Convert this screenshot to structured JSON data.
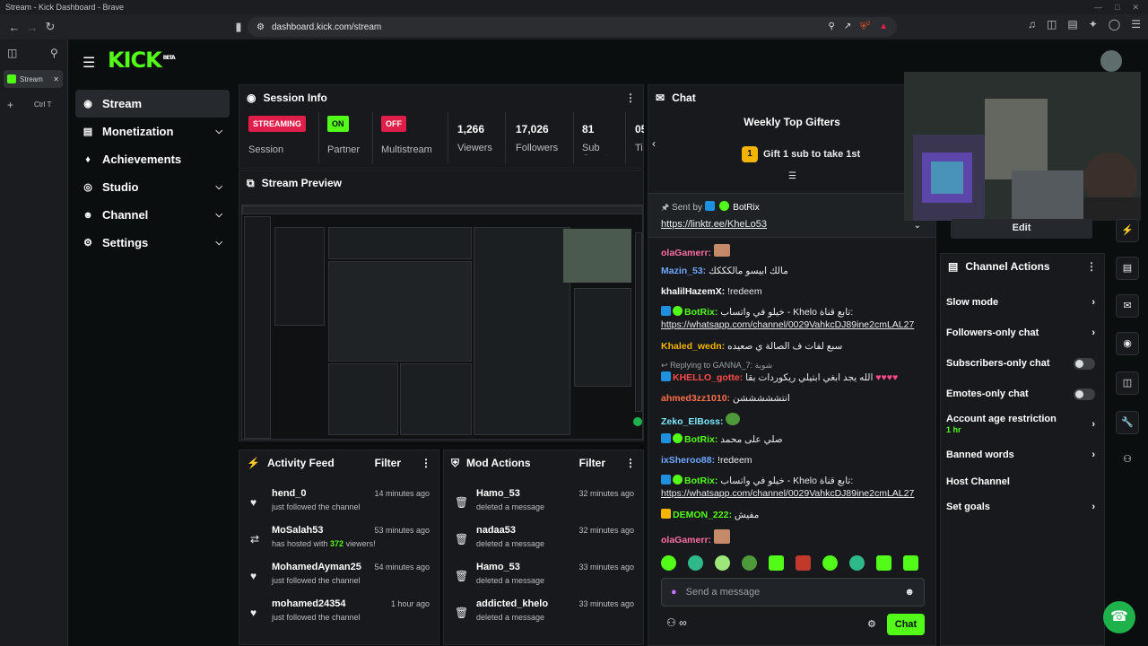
{
  "browser": {
    "window_title": "Stream - Kick Dashboard - Brave",
    "url": "dashboard.kick.com/stream",
    "tab_title": "Stream",
    "new_tab_hint": "Ctrl T",
    "shield_count": "2"
  },
  "app": {
    "logo": "KICK",
    "logo_badge": "BETA"
  },
  "sidebar": {
    "items": [
      {
        "label": "Stream",
        "icon": "stream-icon"
      },
      {
        "label": "Monetization",
        "icon": "dollar-icon"
      },
      {
        "label": "Achievements",
        "icon": "trophy-icon"
      },
      {
        "label": "Studio",
        "icon": "studio-icon"
      },
      {
        "label": "Channel",
        "icon": "user-icon"
      },
      {
        "label": "Settings",
        "icon": "gear-icon"
      }
    ]
  },
  "session": {
    "title": "Session Info",
    "streaming_badge": "STREAMING",
    "session_label": "Session",
    "partner_badge": "ON",
    "partner_label": "Partner",
    "multistream_badge": "OFF",
    "multistream_label": "Multistream",
    "viewers": "1,266",
    "viewers_label": "Viewers",
    "followers": "17,026",
    "followers_label": "Followers",
    "subs": "81",
    "subs_label": "Sub Counts",
    "extra_num": "05",
    "extra_label": "Ti"
  },
  "preview": {
    "title": "Stream Preview"
  },
  "activity": {
    "title": "Activity Feed",
    "filter": "Filter",
    "rows": [
      {
        "name": "hend_0",
        "sub": "just followed the channel",
        "time": "14 minutes ago"
      },
      {
        "name": "MoSalah53",
        "sub_pre": "has hosted with ",
        "sub_hl": "372",
        "sub_post": " viewers!",
        "time": "53 minutes ago"
      },
      {
        "name": "MohamedAyman25",
        "sub": "just followed the channel",
        "time": "54 minutes ago"
      },
      {
        "name": "mohamed24354",
        "sub": "just followed the channel",
        "time": "1 hour ago"
      }
    ]
  },
  "mod_actions": {
    "title": "Mod Actions",
    "filter": "Filter",
    "rows": [
      {
        "name": "Hamo_53",
        "sub": "deleted a message",
        "time": "32 minutes ago"
      },
      {
        "name": "nadaa53",
        "sub": "deleted a message",
        "time": "32 minutes ago"
      },
      {
        "name": "Hamo_53",
        "sub": "deleted a message",
        "time": "33 minutes ago"
      },
      {
        "name": "addicted_khelo",
        "sub": "deleted a message",
        "time": "33 minutes ago"
      }
    ]
  },
  "chat": {
    "title": "Chat",
    "gifters_title": "Weekly Top Gifters",
    "gifters_rank": "1",
    "gifters_cta": "Gift 1 sub to take 1st",
    "pinned_sent_by": "Sent by",
    "pinned_user": "BotRix",
    "pinned_link": "https://linktr.ee/KheLo53",
    "messages": [
      {
        "user": "olaGamerr:",
        "color": "#ff6ea1",
        "text": ""
      },
      {
        "user": "Mazin_53:",
        "color": "#6fa8ff",
        "text": "مالك ابيسو مالكككك"
      },
      {
        "user": "khalilHazemX:",
        "color": "#ffffff",
        "text": "!redeem"
      },
      {
        "user": "BotRix:",
        "color": "#53fc18",
        "text": "خيلو في واتساب - Khelo تابع قناة:",
        "link": "https://whatsapp.com/channel/0029VahkcDJ89ine2cmLAL27"
      },
      {
        "user": "Khaled_wedn:",
        "color": "#f5b400",
        "text": "سبع لفات ف الصالة ي صعيده"
      },
      {
        "reply": "Replying to GANNA_7: شوية"
      },
      {
        "user": "KHELLO_gotte:",
        "color": "#ff4b4b",
        "text": "الله يجد ابغي ابتيلي ريكوردات بقا"
      },
      {
        "user": "ahmed3zz1010:",
        "color": "#ff6e4a",
        "text": "انتشششششن"
      },
      {
        "user": "Zeko_ElBoss:",
        "color": "#7fe8ff",
        "text": ""
      },
      {
        "user": "BotRix:",
        "color": "#53fc18",
        "text": "صلي على محمد"
      },
      {
        "user": "ixSheroo88:",
        "color": "#6fa8ff",
        "text": "!redeem"
      },
      {
        "user": "BotRix:",
        "color": "#53fc18",
        "text": "خيلو في واتساب - Khelo تابع قناة:",
        "link": "https://whatsapp.com/channel/0029VahkcDJ89ine2cmLAL27"
      },
      {
        "user": "DEMON_222:",
        "color": "#53fc18",
        "text": "مفيش"
      },
      {
        "user": "olaGamerr:",
        "color": "#ff6ea1",
        "text": ""
      }
    ],
    "input_placeholder": "Send a message",
    "send_button": "Chat"
  },
  "webcam": {
    "edit_button": "Edit"
  },
  "channel_actions": {
    "title": "Channel Actions",
    "rows": [
      {
        "label": "Slow mode",
        "kind": "chevron"
      },
      {
        "label": "Followers-only chat",
        "kind": "chevron"
      },
      {
        "label": "Subscribers-only chat",
        "kind": "toggle"
      },
      {
        "label": "Emotes-only chat",
        "kind": "toggle"
      },
      {
        "label": "Account age restriction",
        "kind": "chevron",
        "sub": "1 hr"
      },
      {
        "label": "Banned words",
        "kind": "chevron"
      },
      {
        "label": "Host Channel",
        "kind": "none"
      },
      {
        "label": "Set goals",
        "kind": "chevron"
      }
    ]
  }
}
